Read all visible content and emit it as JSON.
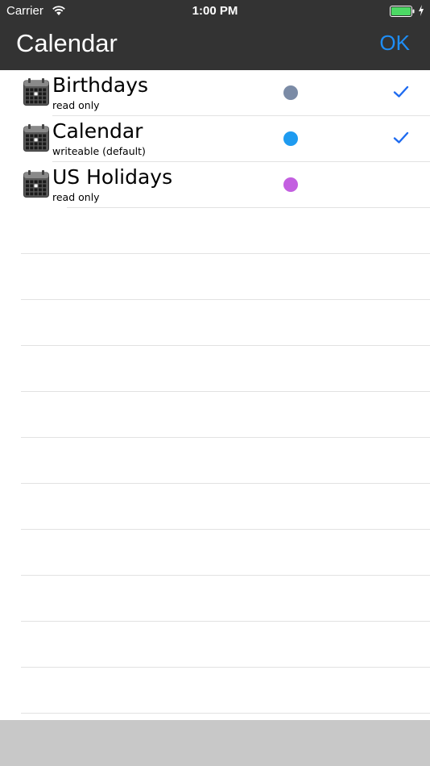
{
  "status_bar": {
    "carrier": "Carrier",
    "time": "1:00 PM",
    "wifi_icon": "wifi-icon",
    "battery_icon": "battery-icon",
    "battery_level": 1.0,
    "battery_color": "#4cd964",
    "charging_icon": "charging-bolt-icon"
  },
  "nav": {
    "title": "Calendar",
    "ok_label": "OK",
    "bar_color": "#333333",
    "accent_color": "#1e8ef7"
  },
  "calendars": [
    {
      "name": "Birthdays",
      "description": "read only",
      "color": "#7b8ba6",
      "checked": true,
      "icon": "calendar-icon"
    },
    {
      "name": "Calendar",
      "description": "writeable (default)",
      "color": "#1e9bf0",
      "checked": true,
      "icon": "calendar-icon"
    },
    {
      "name": "US Holidays",
      "description": "read only",
      "color": "#c35fe0",
      "checked": false,
      "icon": "calendar-icon"
    }
  ],
  "check_color": "#1e6bf0",
  "toolbar": {
    "color": "#c8c8c8"
  }
}
